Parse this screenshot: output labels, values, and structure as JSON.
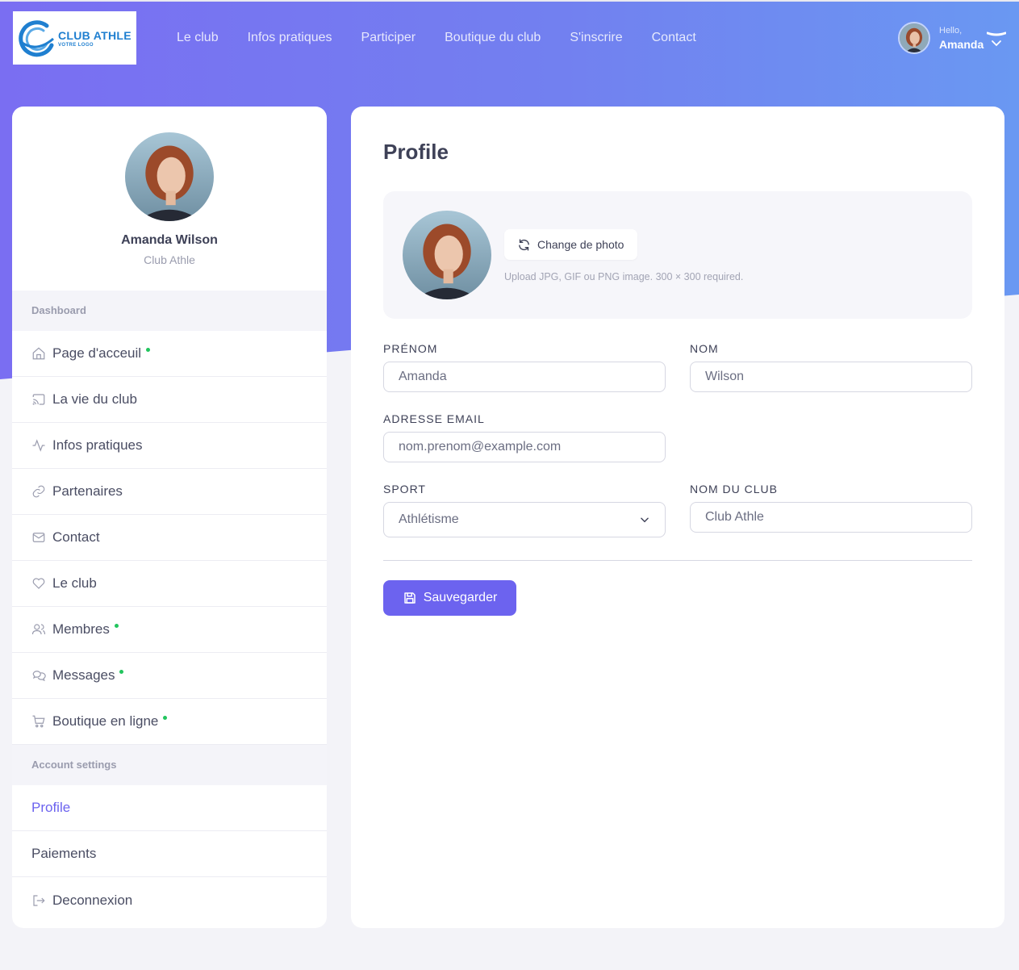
{
  "brand": {
    "title": "CLUB ATHLE",
    "subtitle": "VOTRE LOGO"
  },
  "nav": [
    "Le club",
    "Infos pratiques",
    "Participer",
    "Boutique du club",
    "S'inscrire",
    "Contact"
  ],
  "user": {
    "greeting": "Hello,",
    "name": "Amanda"
  },
  "sidebar": {
    "name": "Amanda Wilson",
    "club": "Club Athle",
    "section1": "Dashboard",
    "items": [
      {
        "label": "Page d'acceuil",
        "icon": "home-icon",
        "dot": true
      },
      {
        "label": "La vie du club",
        "icon": "cast-icon",
        "dot": false
      },
      {
        "label": "Infos pratiques",
        "icon": "activity-icon",
        "dot": false
      },
      {
        "label": "Partenaires",
        "icon": "link-icon",
        "dot": false
      },
      {
        "label": "Contact",
        "icon": "mail-icon",
        "dot": false
      },
      {
        "label": "Le club",
        "icon": "heart-icon",
        "dot": false
      },
      {
        "label": "Membres",
        "icon": "users-icon",
        "dot": true
      },
      {
        "label": "Messages",
        "icon": "chat-icon",
        "dot": true
      },
      {
        "label": "Boutique en ligne",
        "icon": "cart-icon",
        "dot": true
      }
    ],
    "section2": "Account settings",
    "settings": [
      {
        "label": "Profile",
        "active": true
      },
      {
        "label": "Paiements",
        "active": false
      },
      {
        "label": "Deconnexion",
        "icon": "logout-icon"
      }
    ]
  },
  "main": {
    "title": "Profile",
    "change_photo": "Change de photo",
    "photo_hint": "Upload JPG, GIF ou PNG image. 300 × 300 required.",
    "firstname_label": "PRÉNOM",
    "firstname_value": "Amanda",
    "lastname_label": "NOM",
    "lastname_value": "Wilson",
    "email_label": "ADRESSE EMAIL",
    "email_placeholder": "nom.prenom@example.com",
    "sport_label": "SPORT",
    "sport_value": "Athlétisme",
    "club_label": "NOM DU CLUB",
    "club_value": "Club Athle",
    "save": "Sauvegarder"
  },
  "colors": {
    "accent": "#6c63ef",
    "status_dot": "#22c55e",
    "hero_start": "#7a6ef2",
    "hero_end": "#6a98f2"
  }
}
